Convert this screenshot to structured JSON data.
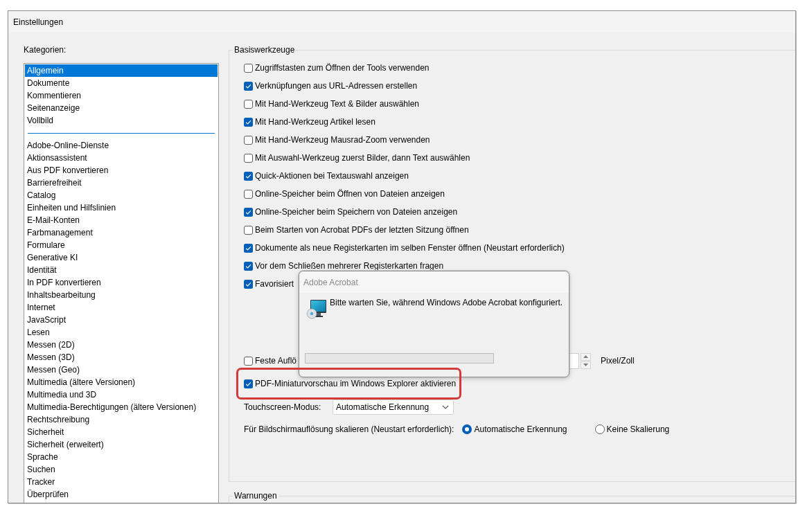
{
  "window": {
    "title": "Einstellungen"
  },
  "categories": {
    "label": "Kategorien:",
    "groups": [
      {
        "items": [
          {
            "label": "Allgemein",
            "selected": true
          },
          {
            "label": "Dokumente",
            "selected": false
          },
          {
            "label": "Kommentieren",
            "selected": false
          },
          {
            "label": "Seitenanzeige",
            "selected": false
          },
          {
            "label": "Vollbild",
            "selected": false
          }
        ]
      },
      {
        "items": [
          {
            "label": "Adobe-Online-Dienste",
            "selected": false
          },
          {
            "label": "Aktionsassistent",
            "selected": false
          },
          {
            "label": "Aus PDF konvertieren",
            "selected": false
          },
          {
            "label": "Barrierefreiheit",
            "selected": false
          },
          {
            "label": "Catalog",
            "selected": false
          },
          {
            "label": "Einheiten und Hilfslinien",
            "selected": false
          },
          {
            "label": "E-Mail-Konten",
            "selected": false
          },
          {
            "label": "Farbmanagement",
            "selected": false
          },
          {
            "label": "Formulare",
            "selected": false
          },
          {
            "label": "Generative KI",
            "selected": false
          },
          {
            "label": "Identität",
            "selected": false
          },
          {
            "label": "In PDF konvertieren",
            "selected": false
          },
          {
            "label": "Inhaltsbearbeitung",
            "selected": false
          },
          {
            "label": "Internet",
            "selected": false
          },
          {
            "label": "JavaScript",
            "selected": false
          },
          {
            "label": "Lesen",
            "selected": false
          },
          {
            "label": "Messen (2D)",
            "selected": false
          },
          {
            "label": "Messen (3D)",
            "selected": false
          },
          {
            "label": "Messen (Geo)",
            "selected": false
          },
          {
            "label": "Multimedia (ältere Versionen)",
            "selected": false
          },
          {
            "label": "Multimedia und 3D",
            "selected": false
          },
          {
            "label": "Multimedia-Berechtigungen (ältere Versionen)",
            "selected": false
          },
          {
            "label": "Rechtschreibung",
            "selected": false
          },
          {
            "label": "Sicherheit",
            "selected": false
          },
          {
            "label": "Sicherheit (erweitert)",
            "selected": false
          },
          {
            "label": "Sprache",
            "selected": false
          },
          {
            "label": "Suchen",
            "selected": false
          },
          {
            "label": "Tracker",
            "selected": false
          },
          {
            "label": "Überprüfen",
            "selected": false
          }
        ]
      }
    ]
  },
  "basic_tools": {
    "title": "Basiswerkzeuge",
    "options": [
      {
        "kind": "checkbox",
        "label": "Zugriffstasten zum Öffnen der Tools verwenden",
        "checked": false,
        "highlighted": false
      },
      {
        "kind": "checkbox",
        "label": "Verknüpfungen aus URL-Adressen erstellen",
        "checked": true,
        "highlighted": false
      },
      {
        "kind": "checkbox",
        "label": "Mit Hand-Werkzeug Text & Bilder auswählen",
        "checked": false,
        "highlighted": false
      },
      {
        "kind": "checkbox",
        "label": "Mit Hand-Werkzeug Artikel lesen",
        "checked": true,
        "highlighted": false
      },
      {
        "kind": "checkbox",
        "label": "Mit Hand-Werkzeug Mausrad-Zoom verwenden",
        "checked": false,
        "highlighted": false
      },
      {
        "kind": "checkbox",
        "label": "Mit Auswahl-Werkzeug zuerst Bilder, dann Text auswählen",
        "checked": false,
        "highlighted": false
      },
      {
        "kind": "checkbox",
        "label": "Quick-Aktionen bei Textauswahl anzeigen",
        "checked": true,
        "highlighted": false
      },
      {
        "kind": "checkbox",
        "label": "Online-Speicher beim Öffnen von Dateien anzeigen",
        "checked": false,
        "highlighted": false
      },
      {
        "kind": "checkbox",
        "label": "Online-Speicher beim Speichern von Dateien anzeigen",
        "checked": true,
        "highlighted": false
      },
      {
        "kind": "checkbox",
        "label": "Beim Starten von Acrobat PDFs der letzten Sitzung öffnen",
        "checked": false,
        "highlighted": false
      },
      {
        "kind": "checkbox",
        "label": "Dokumente als neue Registerkarten im selben Fenster öffnen (Neustart erforderlich)",
        "checked": true,
        "highlighted": false
      },
      {
        "kind": "checkbox",
        "label": "Vor dem Schließen mehrerer Registerkarten fragen",
        "checked": true,
        "highlighted": false
      },
      {
        "kind": "checkbox",
        "label": "Favorisiert",
        "checked": true,
        "highlighted": false
      },
      {
        "kind": "checkbox_spin",
        "label": "Feste Auflö",
        "checked": false,
        "unit": "Pixel/Zoll",
        "highlighted": false
      },
      {
        "kind": "checkbox",
        "label": "PDF-Miniaturvorschau im Windows Explorer aktivieren",
        "checked": true,
        "highlighted": true
      },
      {
        "kind": "dropdown",
        "label": "Touchscreen-Modus:",
        "value": "Automatische Erkennung",
        "highlighted": false
      },
      {
        "kind": "radio_group",
        "label": "Für Bildschirmauflösung skalieren (Neustart erforderlich):",
        "highlighted": false,
        "options": [
          {
            "label": "Automatische Erkennung",
            "selected": true
          },
          {
            "label": "Keine Skalierung",
            "selected": false
          }
        ]
      }
    ]
  },
  "warnings": {
    "title": "Warnungen"
  },
  "dialog": {
    "title": "Adobe Acrobat",
    "message": "Bitte warten Sie, während Windows Adobe Acrobat konfiguriert.",
    "progress": {
      "level": 0
    }
  }
}
